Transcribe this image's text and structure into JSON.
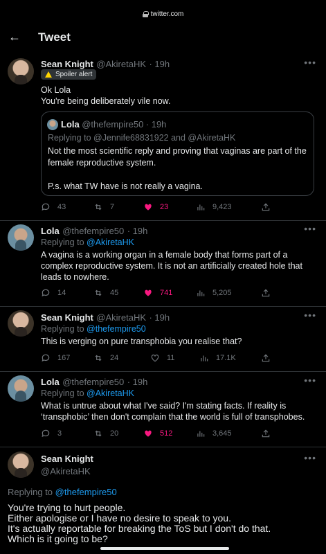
{
  "browser": {
    "url": "twitter.com"
  },
  "header": {
    "back_label": "←",
    "title": "Tweet"
  },
  "tweets": [
    {
      "name": "Sean Knight",
      "handle": "@AkiretaHK",
      "time": "· 19h",
      "badge": "Spoiler alert",
      "text": [
        "Ok Lola",
        "You're being deliberately vile now."
      ],
      "quote": {
        "name": "Lola",
        "handle": "@thefempire50",
        "time": "· 19h",
        "replying": "Replying to @Jennife68831922 and @AkiretaHK",
        "text1": "Not the most scientific reply and proving that vaginas are part of the female reproductive system.",
        "text2": "P.s. what TW have is not really a vagina."
      },
      "stats": {
        "replies": "43",
        "retweets": "7",
        "likes": "23",
        "views": "9,423"
      }
    },
    {
      "name": "Lola",
      "handle": "@thefempire50",
      "time": "· 19h",
      "replying_prefix": "Replying to",
      "replying_handle": "@AkiretaHK",
      "text": "A vagina is a working organ in a female body that forms part of a complex reproductive system. It is not an artificially created hole that leads to nowhere.",
      "stats": {
        "replies": "14",
        "retweets": "45",
        "likes": "741",
        "views": "5,205"
      }
    },
    {
      "name": "Sean Knight",
      "handle": "@AkiretaHK",
      "time": "· 19h",
      "replying_prefix": "Replying to",
      "replying_handle": "@thefempire50",
      "text": "This is verging on pure transphobia you realise that?",
      "stats": {
        "replies": "167",
        "retweets": "24",
        "likes": "11",
        "views": "17.1K"
      }
    },
    {
      "name": "Lola",
      "handle": "@thefempire50",
      "time": "· 19h",
      "replying_prefix": "Replying to",
      "replying_handle": "@AkiretaHK",
      "text": "What is untrue about what I've said? I'm stating facts. If reality is ‘transphobic’ then don't complain that the world is full of transphobes.",
      "stats": {
        "replies": "3",
        "retweets": "20",
        "likes": "512",
        "views": "3,645"
      }
    }
  ],
  "main_tweet": {
    "name": "Sean Knight",
    "handle": "@AkiretaHK",
    "replying_prefix": "Replying to",
    "replying_handle": "@thefempire50",
    "lines": [
      "You're trying to hurt people.",
      "Either apologise or I have no desire to speak to you.",
      "It's actually reportable for breaking the ToS but I don't do that.",
      "Which is it going to be?"
    ]
  },
  "colors": {
    "accent": "#1d9bf0",
    "like": "#f91880",
    "muted": "#71767b",
    "background": "#000000"
  },
  "icons": [
    "lock-icon",
    "back-arrow-icon",
    "more-icon",
    "warning-icon",
    "reply-icon",
    "retweet-icon",
    "heart-icon",
    "views-icon",
    "share-icon"
  ]
}
